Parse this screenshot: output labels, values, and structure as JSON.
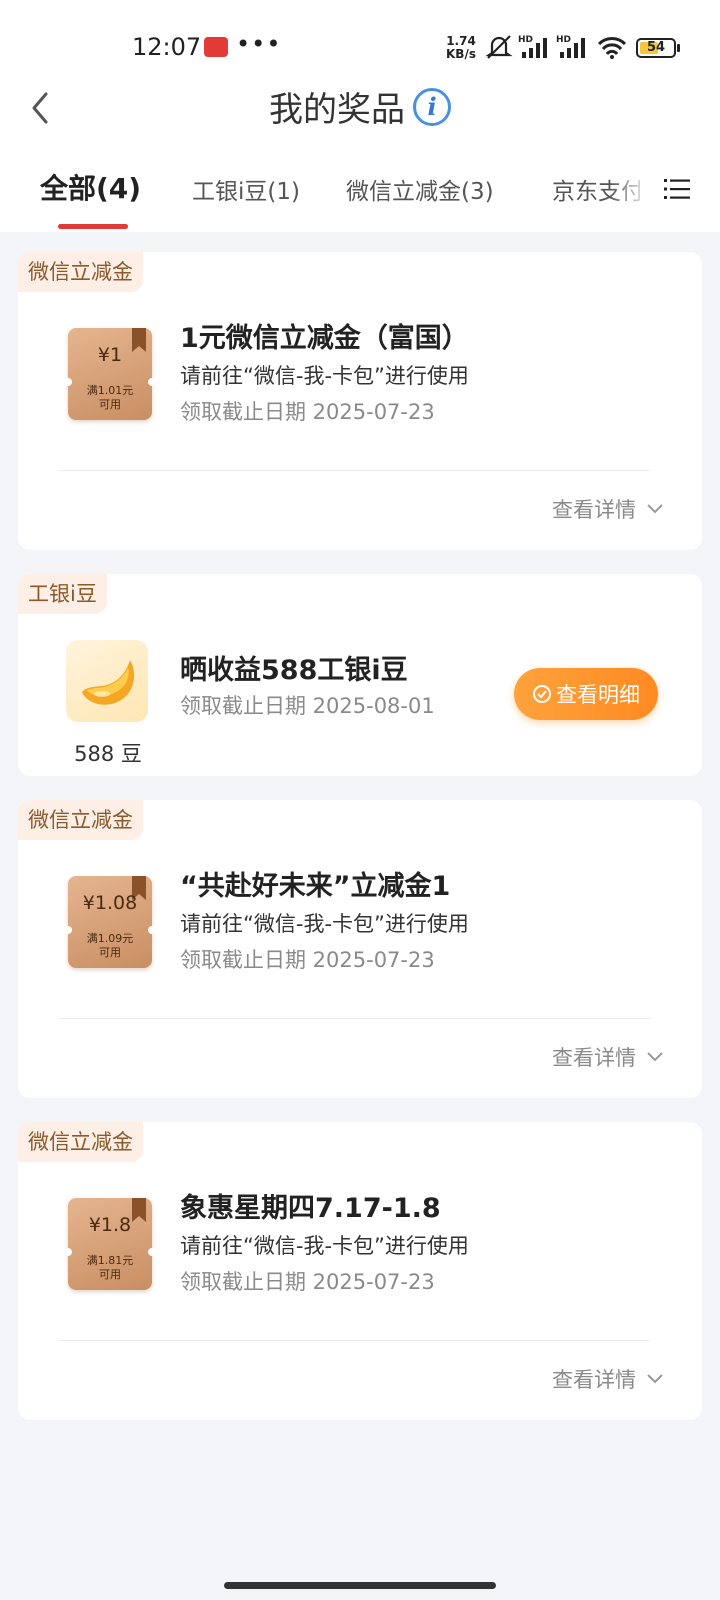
{
  "status_bar": {
    "time": "12:07",
    "more": "•••",
    "net_speed_value": "1.74",
    "net_speed_unit": "KB/s",
    "sig1_label": "HD",
    "sig2_label": "HD",
    "battery": "54"
  },
  "header": {
    "title": "我的奖品"
  },
  "tabs": [
    {
      "label": "全部(4)",
      "active": true
    },
    {
      "label": "工银i豆(1)",
      "active": false
    },
    {
      "label": "微信立减金(3)",
      "active": false
    },
    {
      "label": "京东支付",
      "active": false
    }
  ],
  "cards": [
    {
      "tag": "微信立减金",
      "coupon_amount": "¥1",
      "coupon_cond_1": "满1.01元",
      "coupon_cond_2": "可用",
      "title": "1元微信立减金（富国）",
      "desc": "请前往“微信-我-卡包”进行使用",
      "deadline": "领取截止日期 2025-07-23",
      "detail_label": "查看详情"
    },
    {
      "tag": "工银i豆",
      "bean_label": "588 豆",
      "title": "晒收益588工银i豆",
      "deadline": "领取截止日期 2025-08-01",
      "button_label": "查看明细"
    },
    {
      "tag": "微信立减金",
      "coupon_amount": "¥1.08",
      "coupon_cond_1": "满1.09元",
      "coupon_cond_2": "可用",
      "title": "“共赴好未来”立减金1",
      "desc": "请前往“微信-我-卡包”进行使用",
      "deadline": "领取截止日期 2025-07-23",
      "detail_label": "查看详情"
    },
    {
      "tag": "微信立减金",
      "coupon_amount": "¥1.8",
      "coupon_cond_1": "满1.81元",
      "coupon_cond_2": "可用",
      "title": "象惠星期四7.17-1.8",
      "desc": "请前往“微信-我-卡包”进行使用",
      "deadline": "领取截止日期 2025-07-23",
      "detail_label": "查看详情"
    }
  ],
  "colors": {
    "accent_red": "#e23a36",
    "orange_button": "#ff8a21",
    "tag_bg": "#fdeee6",
    "tag_text": "#8b5a2b",
    "info_blue": "#3778d6"
  }
}
